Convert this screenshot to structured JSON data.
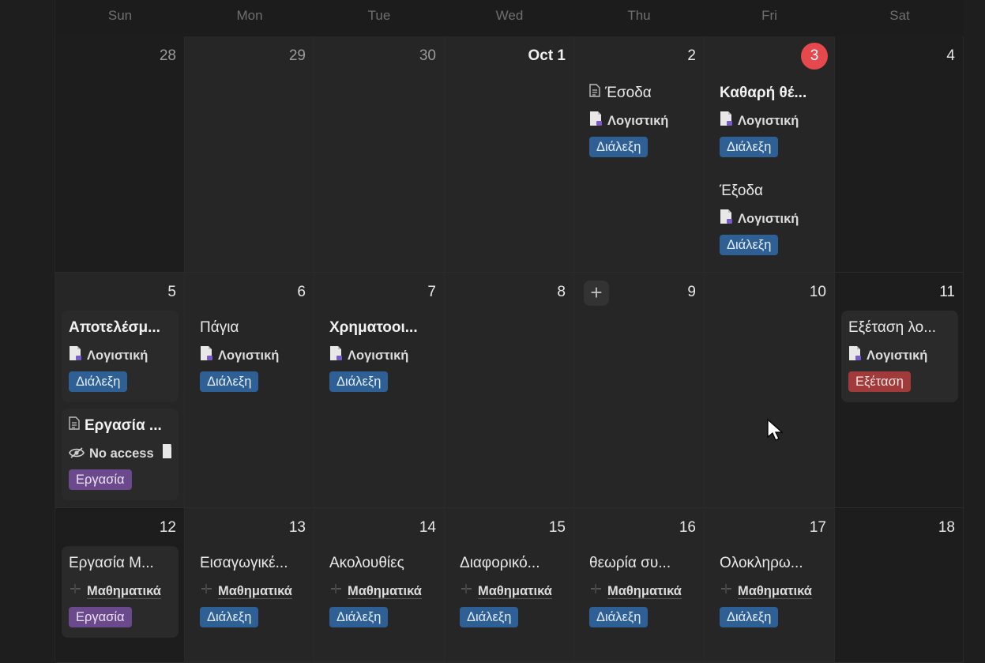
{
  "weekdays": [
    "Sun",
    "Mon",
    "Tue",
    "Wed",
    "Thu",
    "Fri",
    "Sat"
  ],
  "dates": [
    [
      "28",
      "29",
      "30",
      "Oct 1",
      "2",
      "3",
      "4"
    ],
    [
      "5",
      "6",
      "7",
      "8",
      "9",
      "10",
      "11"
    ],
    [
      "12",
      "13",
      "14",
      "15",
      "16",
      "17",
      "18"
    ]
  ],
  "today_date": "3",
  "plus_label": "+",
  "colors": {
    "lecture_tag": "#2e5f95",
    "assignment_tag": "#6a4a8c",
    "exam_tag": "#a13a3a",
    "today_badge": "#e5484d"
  },
  "events": {
    "oct2_a": {
      "title": "Έσοδα",
      "prop": "Λογιστική",
      "tag": "Διάλεξη"
    },
    "oct3_a": {
      "title": "Καθαρή θέ...",
      "prop": "Λογιστική",
      "tag": "Διάλεξη"
    },
    "oct3_b": {
      "title": "Έξοδα",
      "prop": "Λογιστική",
      "tag": "Διάλεξη"
    },
    "oct5_a": {
      "title": "Αποτελέσμ...",
      "prop": "Λογιστική",
      "tag": "Διάλεξη"
    },
    "oct5_b": {
      "title": "Εργασία ...",
      "prop": "No access",
      "tag": "Εργασία"
    },
    "oct6_a": {
      "title": "Πάγια",
      "prop": "Λογιστική",
      "tag": "Διάλεξη"
    },
    "oct7_a": {
      "title": "Χρηματοοι...",
      "prop": "Λογιστική",
      "tag": "Διάλεξη"
    },
    "oct11_a": {
      "title": "Εξέταση λο...",
      "prop": "Λογιστική",
      "tag": "Εξέταση"
    },
    "oct12_a": {
      "title": "Εργασία Μ...",
      "prop": "Μαθηματικά",
      "tag": "Εργασία"
    },
    "oct13_a": {
      "title": "Εισαγωγικέ...",
      "prop": "Μαθηματικά",
      "tag": "Διάλεξη"
    },
    "oct14_a": {
      "title": "Ακολουθίες",
      "prop": "Μαθηματικά",
      "tag": "Διάλεξη"
    },
    "oct15_a": {
      "title": "Διαφορικό...",
      "prop": "Μαθηματικά",
      "tag": "Διάλεξη"
    },
    "oct16_a": {
      "title": "θεωρία συ...",
      "prop": "Μαθηματικά",
      "tag": "Διάλεξη"
    },
    "oct17_a": {
      "title": "Ολοκληρω...",
      "prop": "Μαθηματικά",
      "tag": "Διάλεξη"
    }
  }
}
